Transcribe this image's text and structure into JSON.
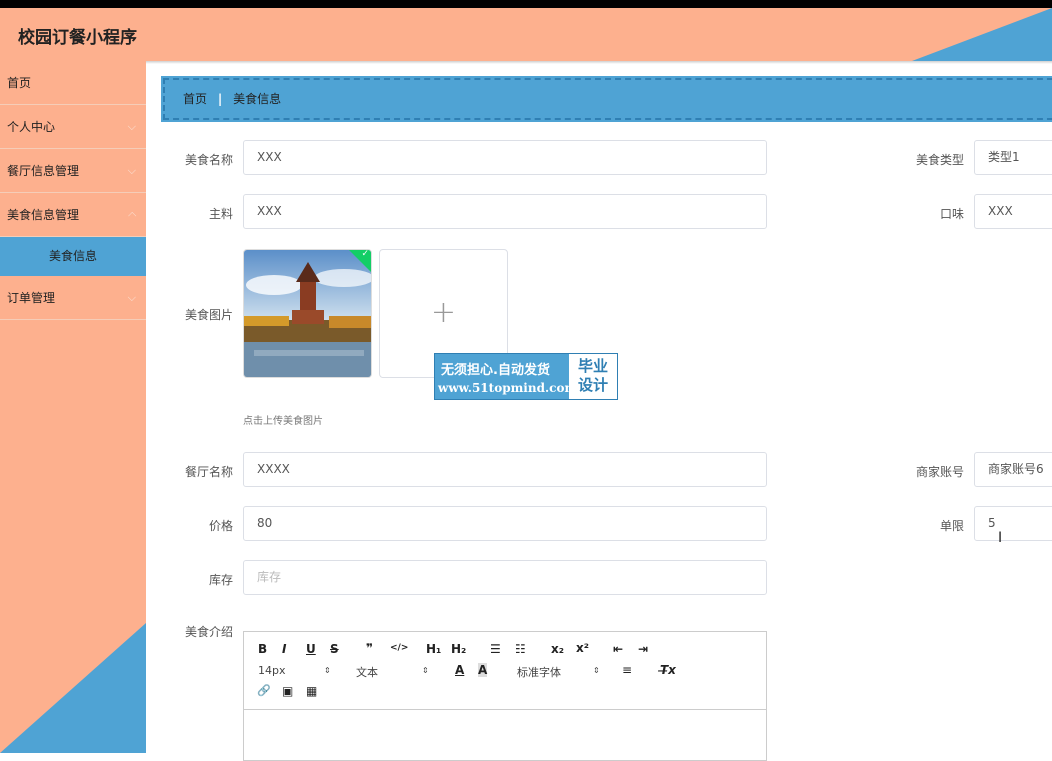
{
  "app": {
    "title": "校园订餐小程序"
  },
  "sidebar": {
    "items": [
      {
        "label": "首页"
      },
      {
        "label": "个人中心"
      },
      {
        "label": "餐厅信息管理"
      },
      {
        "label": "美食信息管理"
      },
      {
        "label": "订单管理"
      }
    ],
    "sub_item": {
      "label": "美食信息"
    },
    "chevron": "⌵"
  },
  "breadcrumb": {
    "home": "首页",
    "separator": "|",
    "current": "美食信息"
  },
  "form": {
    "food_name": {
      "label": "美食名称",
      "value": "XXX"
    },
    "food_type": {
      "label": "美食类型",
      "value": "类型1"
    },
    "ingredient": {
      "label": "主料",
      "value": "XXX"
    },
    "taste": {
      "label": "口味",
      "value": "XXX"
    },
    "food_image": {
      "label": "美食图片",
      "hint": "点击上传美食图片",
      "plus": "+"
    },
    "restaurant_name": {
      "label": "餐厅名称",
      "value": "XXXX"
    },
    "merchant_account": {
      "label": "商家账号",
      "value": "商家账号6"
    },
    "price": {
      "label": "价格",
      "value": "80"
    },
    "limit": {
      "label": "单限",
      "value": "5"
    },
    "stock": {
      "label": "库存",
      "value": "",
      "placeholder": "库存"
    },
    "intro": {
      "label": "美食介绍"
    }
  },
  "editor": {
    "bold": "B",
    "italic": "I",
    "underline": "U",
    "strike": "S",
    "quote": "❞",
    "code": "</>",
    "h1": "H₁",
    "h2": "H₂",
    "ordered_list": "☰",
    "bullet_list": "☷",
    "subscript": "x₂",
    "superscript": "x²",
    "outdent": "⇤",
    "indent": "⇥",
    "font_size": "14px",
    "paragraph": "文本",
    "color": "A",
    "background": "A",
    "font_family": "标准字体",
    "align": "≡",
    "clear_format": "T̶x",
    "link": "🔗",
    "image": "▣",
    "video": "▦",
    "select_arrow": "⇕"
  },
  "watermark": {
    "line1": "无须担心.自动发货",
    "line2": "www.51topmind.com",
    "right_top": "毕业",
    "right_bottom": "设计"
  },
  "colors": {
    "header": "#fdb08e",
    "accent": "#4fa3d4",
    "success": "#13ce66"
  }
}
